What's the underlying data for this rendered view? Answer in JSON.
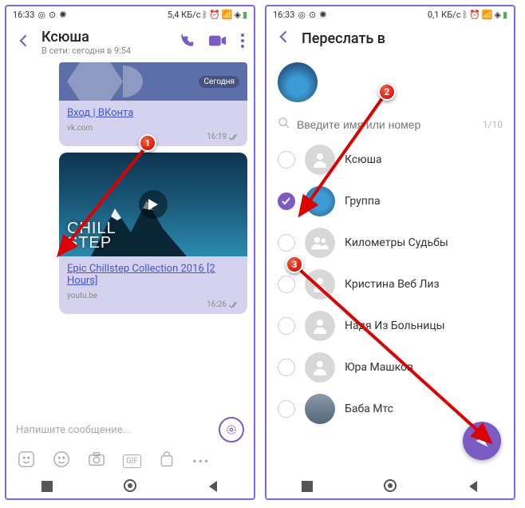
{
  "status": {
    "time": "16:33",
    "data_left": "5,4 КБ/с",
    "data_right": "0,1 КБ/с"
  },
  "left": {
    "title": "Ксюша",
    "subtitle": "В сети: сегодня в 9:54",
    "banner_label": "Сегодня",
    "msg1": {
      "link": "Вход | ВКонта",
      "domain": "vk.com",
      "time": "16:19"
    },
    "msg2": {
      "link": "Epic Chillstep Collection 2016 [2 Hours]",
      "domain": "youtu.be",
      "time": "16:26"
    },
    "video_text_line1": "CHILL",
    "video_text_line2": "STEP",
    "compose_placeholder": "Напишите сообщение..."
  },
  "right": {
    "title": "Переслать в",
    "search_placeholder": "Введите имя или номер",
    "search_count": "1/10",
    "contacts": [
      {
        "name": "Ксюша",
        "checked": false
      },
      {
        "name": "Группа",
        "checked": true
      },
      {
        "name": "Километры Судьбы",
        "checked": false
      },
      {
        "name": "Кристина Веб Лиз",
        "checked": false
      },
      {
        "name": "Надя Из Больницы",
        "checked": false
      },
      {
        "name": "Юра Машков",
        "checked": false
      },
      {
        "name": "Баба Мтс",
        "checked": false
      }
    ]
  },
  "markers": {
    "m1": "1",
    "m2": "2",
    "m3": "3"
  },
  "colors": {
    "accent": "#7b5bc4"
  }
}
